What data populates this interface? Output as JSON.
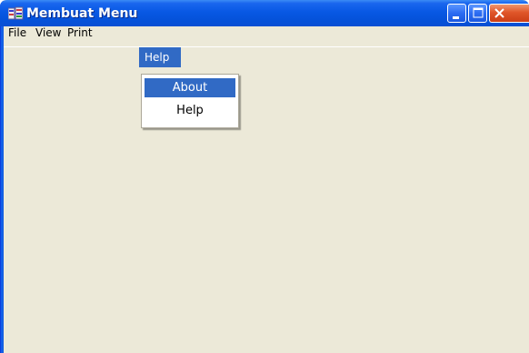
{
  "window": {
    "title": "Membuat Menu",
    "icon": "app-icon",
    "controls": {
      "minimize": "minimize-icon",
      "maximize": "maximize-icon",
      "close": "close-icon"
    },
    "close_color": "#e0562a",
    "title_color": "#0858e4"
  },
  "menubar": {
    "items": [
      {
        "label": "File"
      },
      {
        "label": "View"
      },
      {
        "label": "Print"
      },
      {
        "label": "Help"
      }
    ],
    "active_item": "Help"
  },
  "dropdown": {
    "items": [
      {
        "label": "About",
        "highlighted": true
      },
      {
        "label": "Help",
        "highlighted": false
      }
    ],
    "highlight_color": "#316ac5"
  },
  "client_background": "#ece9d8"
}
